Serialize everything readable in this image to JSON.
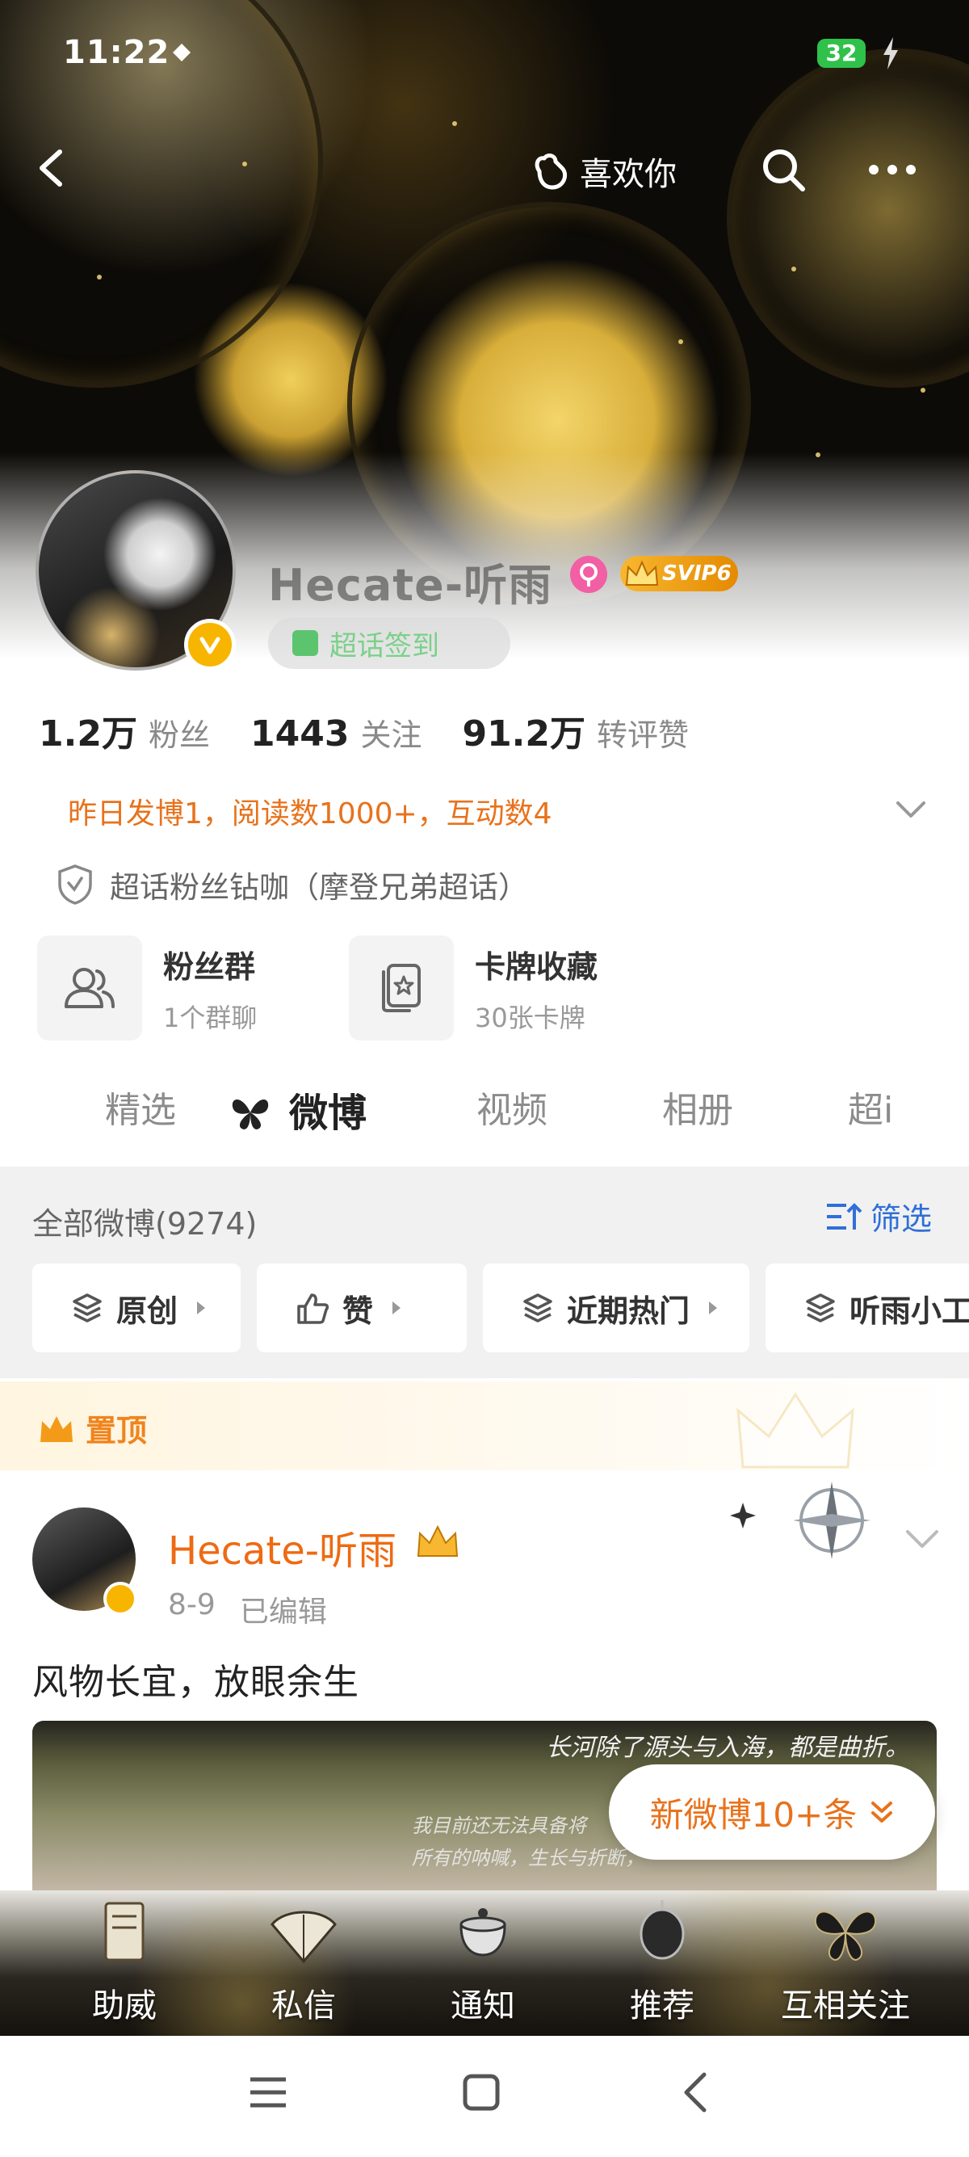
{
  "status_bar": {
    "time": "11:22",
    "battery": "32"
  },
  "topbar": {
    "like_label": "喜欢你"
  },
  "profile": {
    "username": "Hecate-听雨",
    "svip_label": "SVIP6",
    "checkin_label": "超话签到",
    "stats": [
      {
        "num": "1.2万",
        "label": "粉丝"
      },
      {
        "num": "1443",
        "label": "关注"
      },
      {
        "num": "91.2万",
        "label": "转评赞"
      }
    ],
    "activity": "昨日发博1，阅读数1000+，互动数4",
    "fan_title": "超话粉丝钻咖（摩登兄弟超话）"
  },
  "features": [
    {
      "title": "粉丝群",
      "sub": "1个群聊",
      "icon": "people-icon"
    },
    {
      "title": "卡牌收藏",
      "sub": "30张卡牌",
      "icon": "card-icon"
    }
  ],
  "tabs": [
    "精选",
    "微博",
    "视频",
    "相册",
    "超i"
  ],
  "filter": {
    "all_posts": "全部微博(9274)",
    "filter_label": "筛选",
    "chips": [
      "原创",
      "赞",
      "近期热门",
      "听雨小工"
    ]
  },
  "pinned": {
    "label": "置顶",
    "author": "Hecate-听雨",
    "date": "8-9",
    "edited": "已编辑",
    "text": "风物长宜，放眼余生",
    "image_text_1": "长河除了源头与入海，都是曲折。",
    "image_text_2": "我目前还无法具备将",
    "image_text_3": "所有的呐喊，生长与折断，"
  },
  "new_posts_label": "新微博10+条",
  "dock": [
    "助威",
    "私信",
    "通知",
    "推荐",
    "互相关注"
  ],
  "colors": {
    "accent_orange": "#e8721c",
    "link_blue": "#2f6fd8",
    "gold": "#f7b500"
  }
}
